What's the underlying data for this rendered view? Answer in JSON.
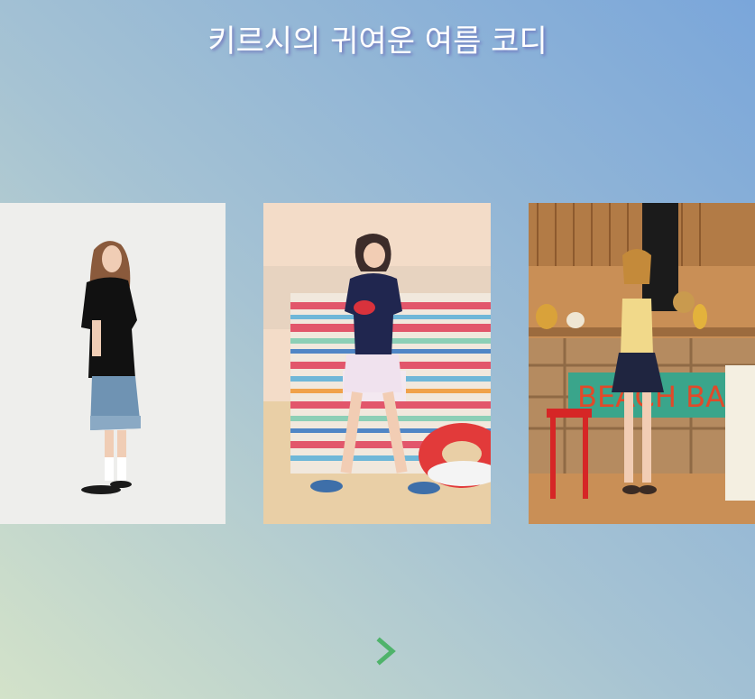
{
  "page": {
    "title": "키르시의 귀여운 여름 코디"
  },
  "carousel": {
    "slides": [
      {
        "description": "model in black t-shirt and denim skirt on white background",
        "icon": "photo"
      },
      {
        "description": "model in navy cherry t-shirt on beach with striped blanket",
        "icon": "photo"
      },
      {
        "description": "model at beach bar with striped top and navy skirt",
        "icon": "photo",
        "sign_text": "BEACH BAR"
      }
    ],
    "next_icon": "chevron-right-icon"
  },
  "colors": {
    "title_text": "#ffffff",
    "accent": "#4fb36b"
  }
}
